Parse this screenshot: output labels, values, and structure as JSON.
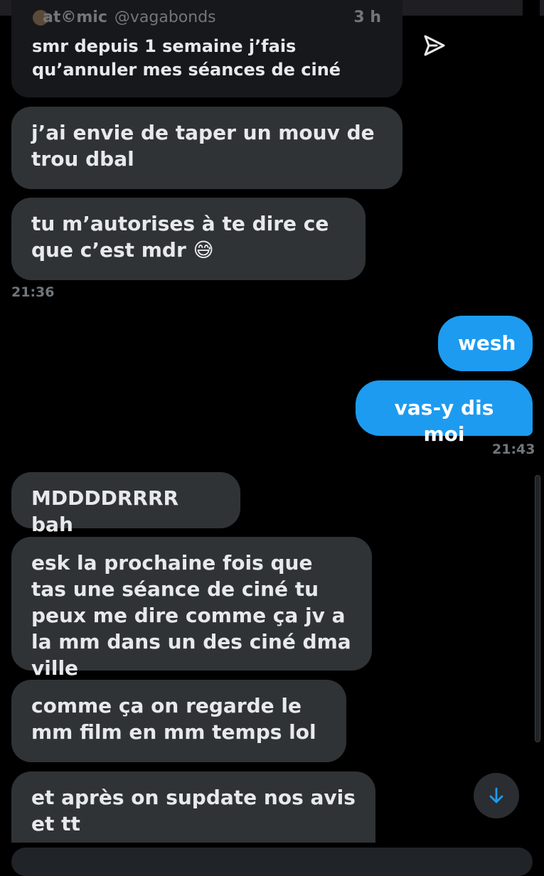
{
  "quoted_tweet": {
    "author_name": "at©mic",
    "author_handle": "@vagabonds",
    "time": "3 h",
    "text": "smr depuis 1 semaine j’fais qu’annuler mes séances de ciné"
  },
  "messages": [
    {
      "side": "received",
      "text": "j’ai envie de taper un mouv de trou dbal"
    },
    {
      "side": "received",
      "text": "tu m’autorises à te dire ce que c’est mdr 😅"
    },
    {
      "side": "received_time",
      "text": "21:36"
    },
    {
      "side": "sent",
      "text": "wesh"
    },
    {
      "side": "sent",
      "text": "vas-y dis moi"
    },
    {
      "side": "sent_time",
      "text": "21:43"
    },
    {
      "side": "received",
      "text": "MDDDDRRRR bah"
    },
    {
      "side": "received",
      "text": "esk la prochaine fois que tas une séance de ciné tu peux me dire comme ça jv a la mm dans un des ciné dma ville"
    },
    {
      "side": "received",
      "text": "comme ça on regarde le mm film en mm temps lol"
    },
    {
      "side": "received",
      "text": "et après on supdate nos avis et tt"
    }
  ],
  "colors": {
    "sent": "#1d9bf0",
    "received": "#2f3336",
    "background": "#000000"
  },
  "icons": {
    "share": "send-icon",
    "scroll_down": "arrow-down-icon"
  }
}
